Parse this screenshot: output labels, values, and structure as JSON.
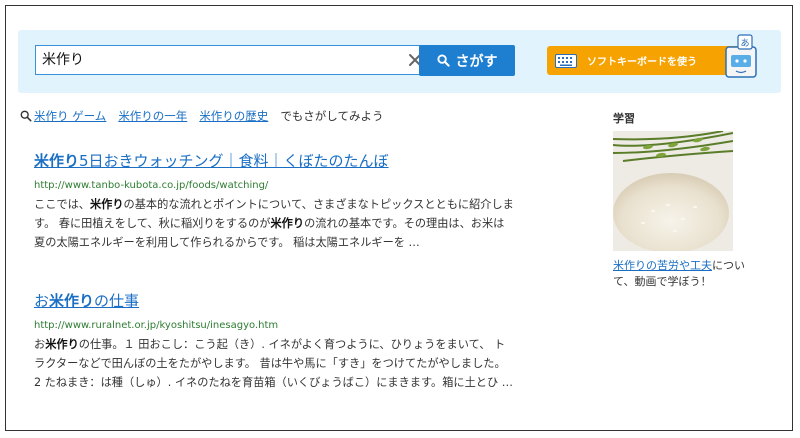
{
  "search": {
    "query": "米作り",
    "button_label": "さがす",
    "keyboard_label": "ソフトキーボードを使う",
    "mascot_badge": "あ"
  },
  "suggestions": {
    "links": [
      "米作り ゲーム",
      "米作りの一年",
      "米作りの歴史"
    ],
    "tail": "でもさがしてみよう"
  },
  "results": [
    {
      "title_bold": "米作り",
      "title_rest": "5日おきウォッチング｜食料｜くぼたのたんぼ",
      "url": "http://www.tanbo-kubota.co.jp/foods/watching/",
      "snippet": [
        "ここでは、",
        "米作り",
        "の基本的な流れとポイントについて、さまざまなトピックスとともに紹介します。 春に田植えをして、秋に稲刈りをするのが",
        "米作り",
        "の流れの基本です。その理由は、お米は夏の太陽エネルギーを利用して作られるからです。 稲は太陽エネルギーを …"
      ]
    },
    {
      "title_prefix": "お",
      "title_bold": "米作り",
      "title_rest": "の仕事",
      "url": "http://www.ruralnet.or.jp/kyoshitsu/inesagyo.htm",
      "snippet": [
        "お",
        "米作り",
        "の仕事。１ 田おこし：こう起（き）. イネがよく育つように、ひりょうをまいて、 トラクターなどで田んぼの土をたがやします。 昔は牛や馬に「すき」をつけてたがやしました。 2 たねまき：は種（しゅ）. イネのたねを育苗箱（いくびょうばこ）にまきます。箱に土とひ …"
      ]
    }
  ],
  "sidebar": {
    "heading": "学習",
    "link_text": "米作りの苦労や工夫",
    "caption_rest": "について、動画で学ぼう！"
  },
  "colors": {
    "accent": "#1e7fd1",
    "link": "#1a6fc4",
    "url": "#2e7d32",
    "keyboard_button": "#f6a200",
    "search_bg": "#e1f3fc"
  }
}
